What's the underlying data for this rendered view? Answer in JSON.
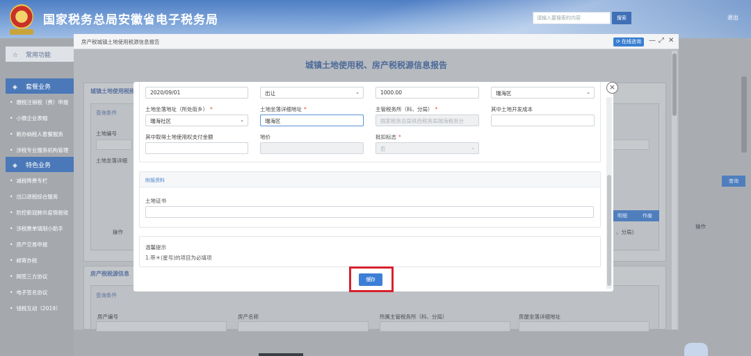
{
  "header": {
    "site_title": "国家税务总局安徽省电子税务局",
    "search_placeholder": "请输入要搜索的内容",
    "search_button": "搜索",
    "logout": "退出"
  },
  "sidebar": {
    "common_label": "常用功能",
    "tax_label": "套餐业务",
    "special_label": "特色业务",
    "tax_items": [
      "缴税注销税（费）申报",
      "小微企业表帽",
      "新办纳税人套餐服务",
      "涉税专业服务机构管理"
    ],
    "special_items": [
      "减税降费专栏",
      "出口退税综合服务",
      "防控新冠肺炎疫情税收",
      "涉税票单填制小助手",
      "房产交易申报",
      "邮寄办税",
      "网签三方协议",
      "电子签名协议",
      "钱税互动（2019）"
    ]
  },
  "background": {
    "panel1_title": "城镇土地使用税税",
    "query_label": "查询条件",
    "land_no": "土地编号",
    "land_addr": "土地坐落详细",
    "op_label": "操作",
    "op_right": "操作",
    "paren": "、分局)",
    "btn_blue": "查询",
    "btn_a": "明细",
    "btn_b": "作废",
    "panel2_title": "房产税税源信息",
    "query_label2": "查询条件",
    "house_no": "房产编号",
    "house_name": "房产名称",
    "house_office": "所属主管税务所（科、分局）",
    "house_addr": "房屋坐落详细地址"
  },
  "modal": {
    "window_title": "房产税城镇土地使用税源信息报告",
    "online_help": "在线咨询",
    "report_title": "城镇土地使用税、房产税税源信息报告"
  },
  "dialog": {
    "row1": {
      "date": "2020/09/01",
      "method": "出让",
      "area": "1000.00",
      "district": "瑞海区"
    },
    "row2": {
      "street_label": "土地坐落地址（所处街乡）",
      "street_value": "瑞海社区",
      "detail_label": "土地坐落详细地址",
      "detail_value": "瑞海区",
      "office_label": "主管税务所（科、分局）",
      "office_value": "国家税务总局铁西税务局瑞海税务分",
      "dev_cost_label": "其中土地开发成本"
    },
    "row3": {
      "pay_label": "其中取得土地使用权支付金额",
      "price_label": "地价",
      "flag_label": "批扣标志",
      "flag_value": "否"
    },
    "attach": {
      "head": "附报资料",
      "cert_label": "土地证书"
    },
    "tip": {
      "title": "温馨提示",
      "text": "1.带＊(星号)的项目为必填项"
    },
    "save_label": "保存"
  },
  "colors": {
    "primary": "#3d7ed6",
    "required": "#e04a3c",
    "highlight": "#d7212d",
    "title_blue": "#4d6a99"
  }
}
